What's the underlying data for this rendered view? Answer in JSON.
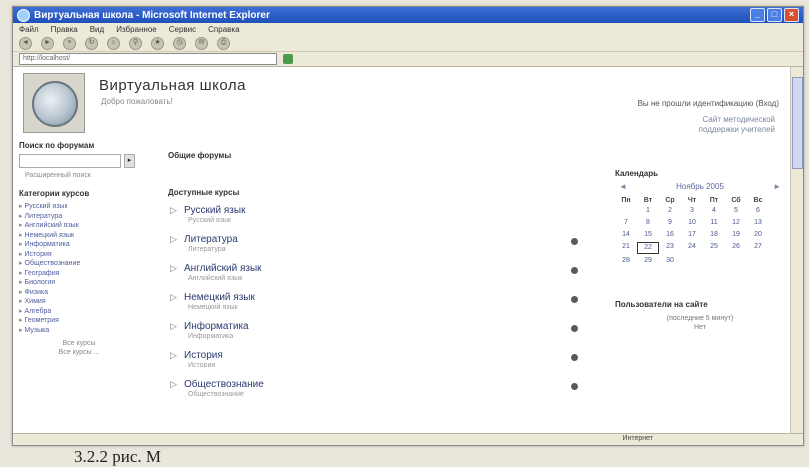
{
  "window": {
    "title": "Виртуальная школа - Microsoft Internet Explorer",
    "menu": [
      "Файл",
      "Правка",
      "Вид",
      "Избранное",
      "Сервис",
      "Справка"
    ],
    "address": "http://localhost/"
  },
  "site": {
    "title": "Виртуальная школа",
    "subtitle": "Добро пожаловать!",
    "login_info": "Вы не прошли идентификацию (Вход)",
    "help_link_line1": "Сайт методической",
    "help_link_line2": "поддержки учителей"
  },
  "left": {
    "search_title": "Поиск по форумам",
    "advanced_search": "Расширенный поиск",
    "categories_title": "Категории курсов",
    "categories": [
      "Русский язык",
      "Литература",
      "Английский язык",
      "Немецкий язык",
      "Информатика",
      "История",
      "Обществознание",
      "География",
      "Биология",
      "Физика",
      "Химия",
      "Алгебра",
      "Геометрия",
      "Музыка"
    ],
    "all_courses_line1": "Все курсы",
    "all_courses_line2": "Все курсы ..."
  },
  "center": {
    "forums_title": "Общие форумы",
    "courses_title": "Доступные курсы",
    "courses": [
      {
        "name": "Русский язык",
        "sub": "Русский язык"
      },
      {
        "name": "Литература",
        "sub": "Литература"
      },
      {
        "name": "Английский язык",
        "sub": "Английский язык"
      },
      {
        "name": "Немецкий язык",
        "sub": "Немецкий язык"
      },
      {
        "name": "Информатика",
        "sub": "Информатика"
      },
      {
        "name": "История",
        "sub": "История"
      },
      {
        "name": "Обществознание",
        "sub": "Обществознание"
      }
    ]
  },
  "right": {
    "calendar_title": "Календарь",
    "prev": "◄",
    "next": "►",
    "month": "Ноябрь 2005",
    "weekdays": [
      "Пн",
      "Вт",
      "Ср",
      "Чт",
      "Пт",
      "Сб",
      "Вс"
    ],
    "days": [
      "",
      "1",
      "2",
      "3",
      "4",
      "5",
      "6",
      "7",
      "8",
      "9",
      "10",
      "11",
      "12",
      "13",
      "14",
      "15",
      "16",
      "17",
      "18",
      "19",
      "20",
      "21",
      "22",
      "23",
      "24",
      "25",
      "26",
      "27",
      "28",
      "29",
      "30",
      "",
      "",
      "",
      "",
      ""
    ],
    "today": "22",
    "users_title": "Пользователи на сайте",
    "users_sub": "(последние 5 минут)",
    "users_none": "Нет"
  },
  "status": {
    "zone": "Интернет"
  },
  "caption": "3.2.2 рис. M"
}
